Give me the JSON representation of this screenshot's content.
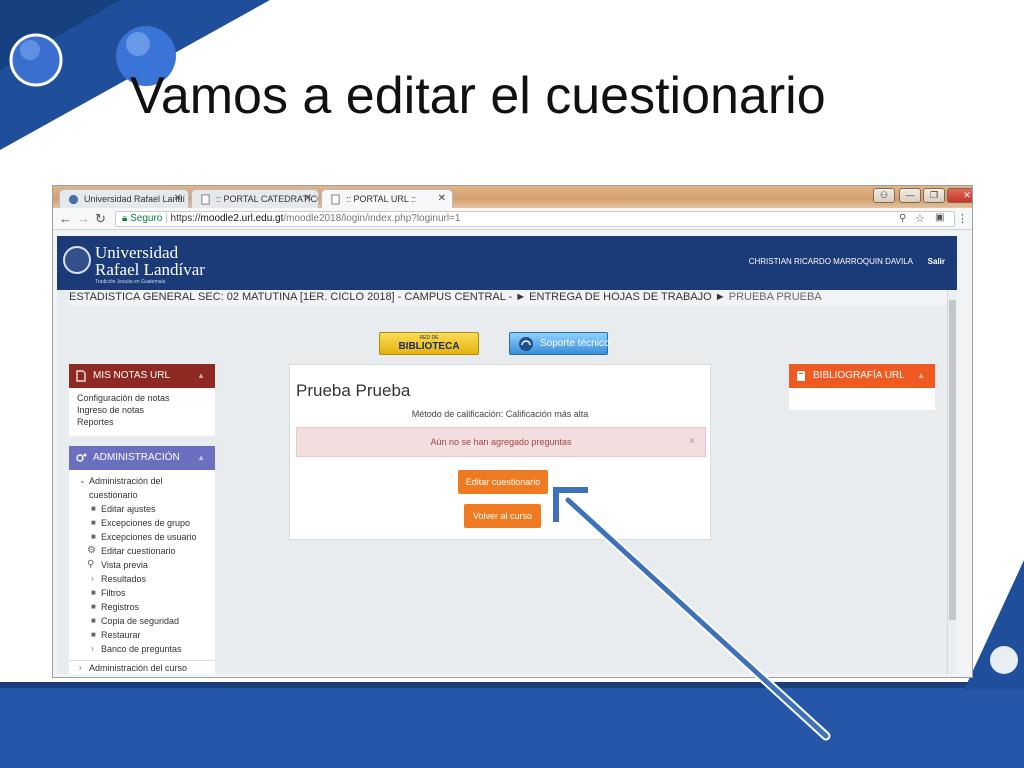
{
  "slide": {
    "title": "Vamos a editar el cuestionario"
  },
  "browser": {
    "tabs": [
      {
        "label": "Universidad Rafael Landí"
      },
      {
        "label": ":: PORTAL CATEDRATICO"
      },
      {
        "label": ":: PORTAL URL ::"
      }
    ],
    "address": {
      "secure_label": "Seguro",
      "scheme": "https://",
      "domain": "moodle2.url.edu.gt",
      "path": "/moodle2018/login/index.php?loginurl=1"
    }
  },
  "site": {
    "logo_line1": "Universidad",
    "logo_line2": "Rafael Landívar",
    "logo_line3": "Tradición Jesuita en Guatemala",
    "user_name": "CHRISTIAN RICARDO MARROQUIN DAVILA",
    "logout": "Salir",
    "breadcrumb": "ESTADISTICA GENERAL SEC: 02 MATUTINA [1ER. CICLO 2018] - CAMPUS CENTRAL - ► ENTREGA DE HOJAS DE TRABAJO ►",
    "breadcrumb_current": "PRUEBA PRUEBA",
    "library_small": "RED DE",
    "library_big": "BIBLIOTECA",
    "support": "Soporte técnico"
  },
  "notas_block": {
    "title": "MIS NOTAS URL",
    "items": [
      "Configuración de notas",
      "Ingreso de notas",
      "Reportes"
    ]
  },
  "admin_block": {
    "title": "ADMINISTRACIÓN",
    "section": "Administración del cuestionario",
    "section_l1": "Administración del",
    "section_l2": "cuestionario",
    "items": [
      "Editar ajustes",
      "Excepciones de grupo",
      "Excepciones de usuario",
      "Editar cuestionario",
      "Vista previa",
      "Resultados",
      "Filtros",
      "Registros",
      "Copia de seguridad",
      "Restaurar",
      "Banco de preguntas"
    ],
    "course_admin": "Administración del curso"
  },
  "biblio_block": {
    "title": "BIBLIOGRAFÍA URL"
  },
  "quiz": {
    "title": "Prueba Prueba",
    "grading_method": "Método de calificación: Calificación más alta",
    "alert": "Aún no se han agregado preguntas",
    "edit_button": "Editar cuestionario",
    "back_button": "Volver al curso"
  },
  "colors": {
    "header": "#1a3a78",
    "orange": "#f07a22",
    "notas_head": "#8f2a22",
    "admin_head": "#6b6fbf",
    "biblio_head": "#f05a22",
    "slide_accent": "#2556a8"
  }
}
